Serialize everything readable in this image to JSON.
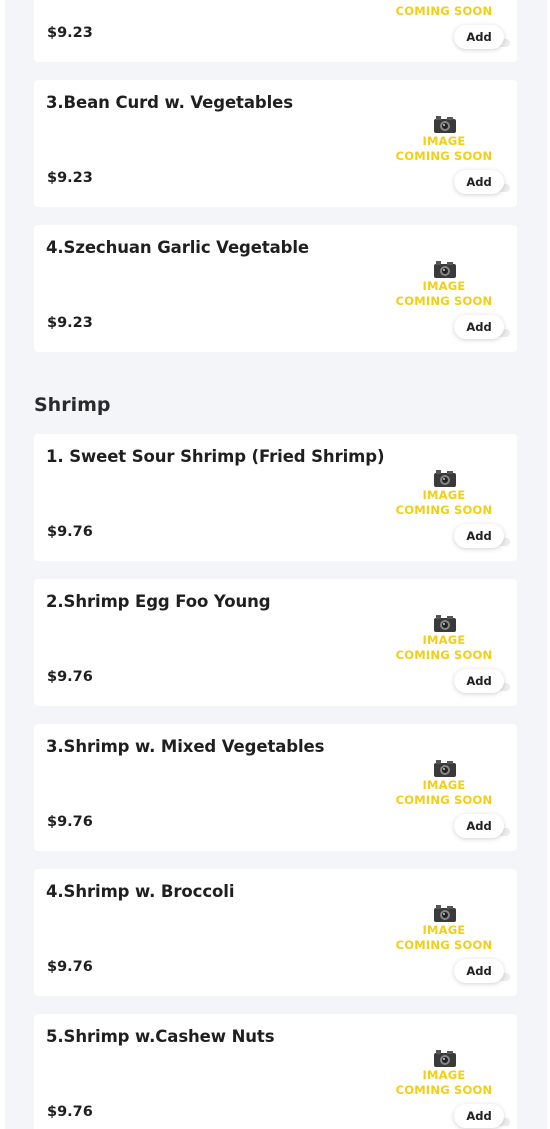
{
  "colors": {
    "background": "#f4f5f9",
    "card": "#ffffff",
    "placeholder_text": "#f2cf14"
  },
  "placeholder": {
    "icon": "camera-icon",
    "line1": "IMAGE",
    "line2": "COMING SOON"
  },
  "add_label": "Add",
  "vegetable_items": [
    {
      "name": "",
      "price": "$9.23"
    },
    {
      "name": "3.Bean Curd w. Vegetables",
      "price": "$9.23"
    },
    {
      "name": "4.Szechuan Garlic Vegetable",
      "price": "$9.23"
    }
  ],
  "shrimp": {
    "title": "Shrimp",
    "items": [
      {
        "name": "1. Sweet Sour Shrimp (Fried Shrimp)",
        "price": "$9.76"
      },
      {
        "name": "2.Shrimp Egg Foo Young",
        "price": "$9.76"
      },
      {
        "name": "3.Shrimp w. Mixed Vegetables",
        "price": "$9.76"
      },
      {
        "name": "4.Shrimp w. Broccoli",
        "price": "$9.76"
      },
      {
        "name": "5.Shrimp w.Cashew Nuts",
        "price": "$9.76"
      }
    ]
  }
}
